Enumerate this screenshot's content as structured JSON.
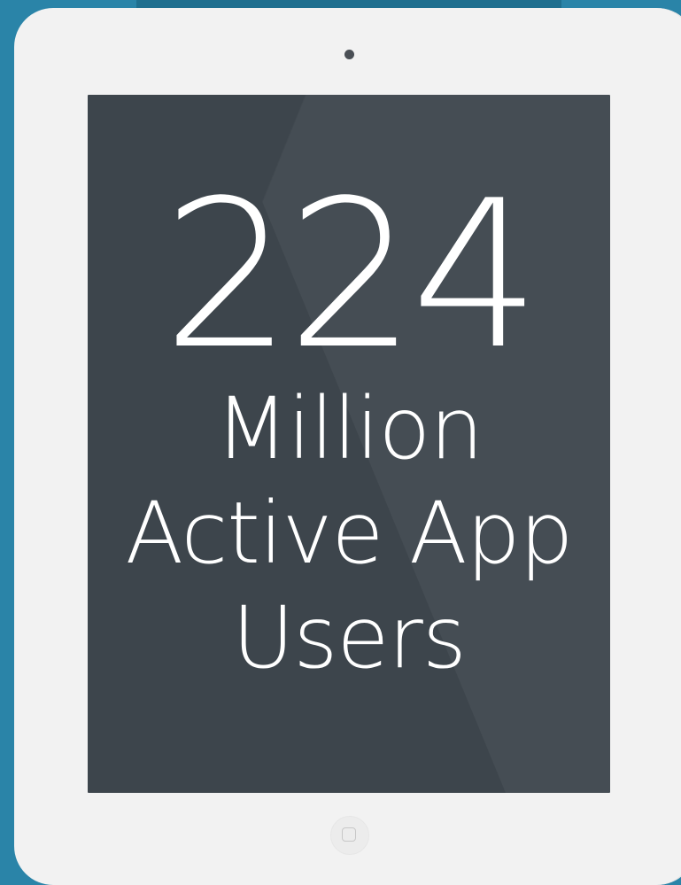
{
  "stat": {
    "number": "224",
    "line1": "Million",
    "line2": "Active App",
    "line3": "Users"
  },
  "colors": {
    "background": "#2a84a8",
    "tablet_body": "#f2f2f2",
    "screen": "#3d454c",
    "text": "#ffffff"
  },
  "icons": {
    "camera": "camera-dot-icon",
    "home": "home-button-icon"
  }
}
